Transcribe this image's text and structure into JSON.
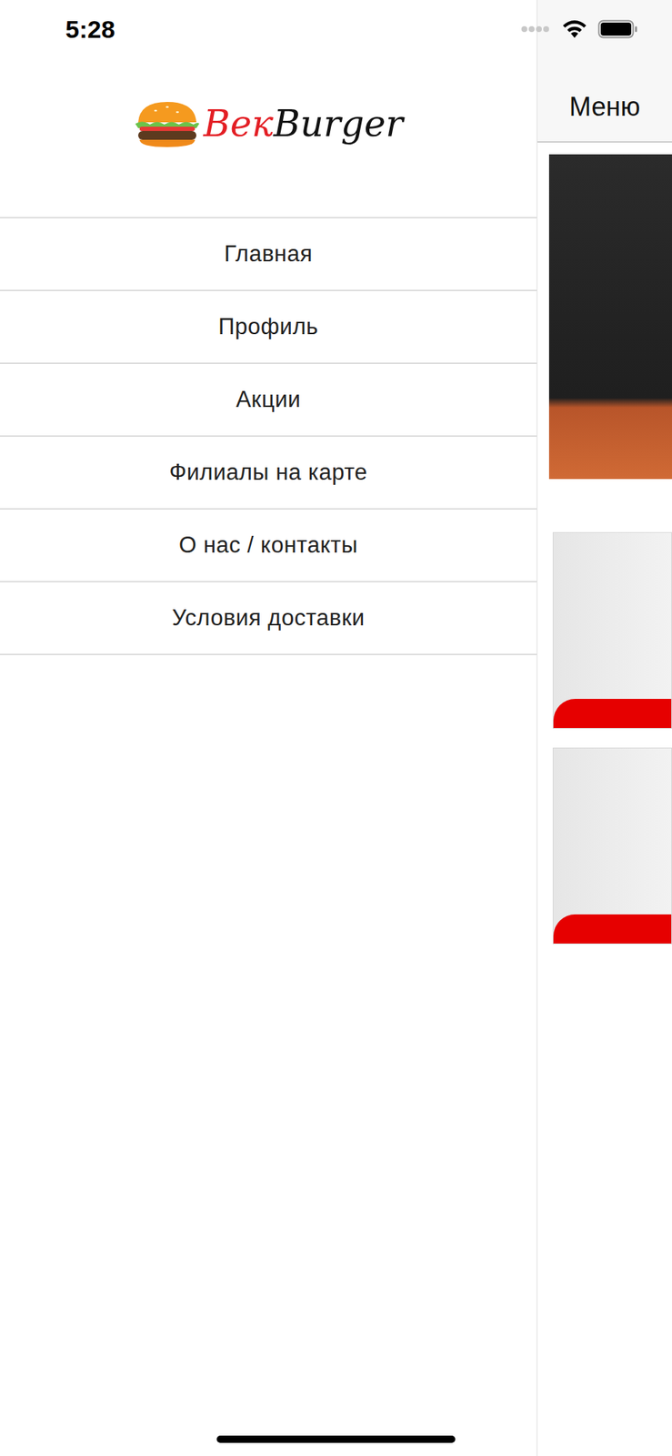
{
  "status_bar": {
    "time": "5:28"
  },
  "logo": {
    "text_red": "Век",
    "text_black": "Burger"
  },
  "drawer": {
    "items": [
      {
        "label": "Главная"
      },
      {
        "label": "Профиль"
      },
      {
        "label": "Акции"
      },
      {
        "label": "Филиалы на карте"
      },
      {
        "label": "О нас / контакты"
      },
      {
        "label": "Условия доставки"
      }
    ]
  },
  "header": {
    "title": "Меню"
  }
}
